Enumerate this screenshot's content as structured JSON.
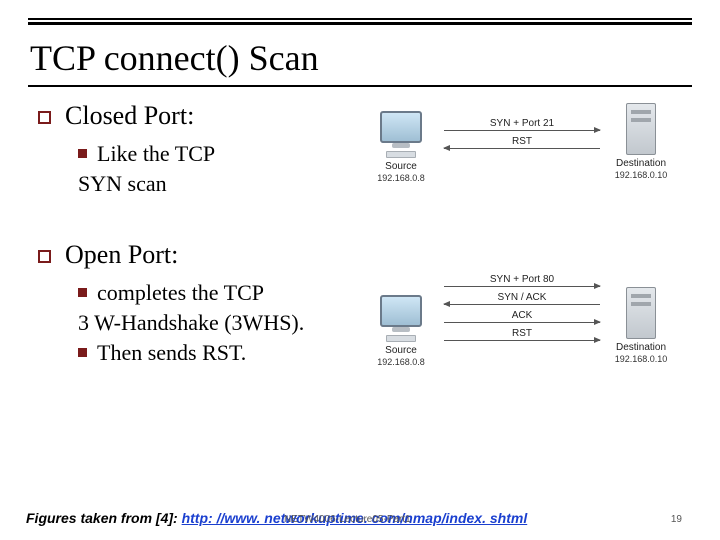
{
  "title": "TCP connect() Scan",
  "sections": [
    {
      "heading": "Closed Port:",
      "bullets": [
        {
          "lead": "Like the TCP",
          "cont": "SYN scan"
        }
      ]
    },
    {
      "heading": "Open Port:",
      "bullets": [
        {
          "lead": "completes the TCP",
          "cont": "3 W-Handshake (3WHS)."
        },
        {
          "lead": "Then sends RST.",
          "cont": ""
        }
      ]
    }
  ],
  "diagrams": [
    {
      "left_label": "Source",
      "left_ip": "192.168.0.8",
      "right_label": "Destination",
      "right_ip": "192.168.0.10",
      "arrows": [
        {
          "dir": "r",
          "label": "SYN + Port 21"
        },
        {
          "dir": "l",
          "label": "RST"
        }
      ]
    },
    {
      "left_label": "Source",
      "left_ip": "192.168.0.8",
      "right_label": "Destination",
      "right_ip": "192.168.0.10",
      "arrows": [
        {
          "dir": "r",
          "label": "SYN + Port 80"
        },
        {
          "dir": "l",
          "label": "SYN / ACK"
        },
        {
          "dir": "r",
          "label": "ACK"
        },
        {
          "dir": "r",
          "label": "RST"
        }
      ]
    }
  ],
  "footer": {
    "prefix": "Figures taken from [4]:  ",
    "link": "http: //www. networkuptime. com/nmap/index. shtml",
    "overprint": "NETW4006-Lecture05-Part1",
    "page": "19"
  }
}
